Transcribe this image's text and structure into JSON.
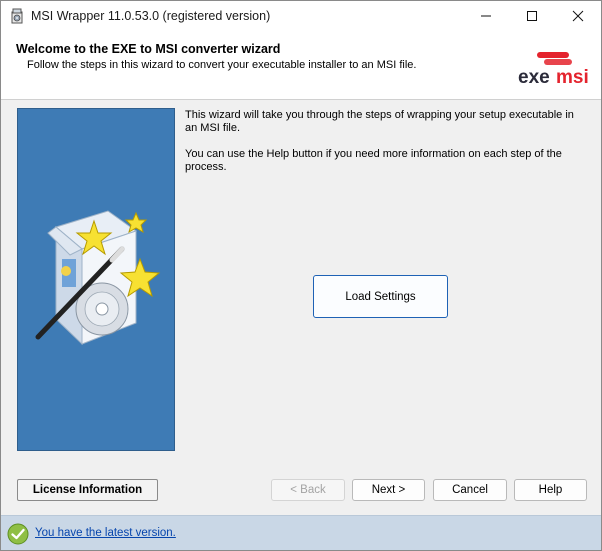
{
  "window": {
    "title": "MSI Wrapper 11.0.53.0 (registered version)"
  },
  "header": {
    "title": "Welcome to the EXE to MSI converter wizard",
    "subtitle": "Follow the steps in this wizard to convert your executable installer to an MSI file.",
    "logo": {
      "text_dark": "exe",
      "text_red": "msi",
      "brand_color": "#e4232d",
      "dark_color": "#2b2b3a"
    }
  },
  "main": {
    "paragraphs": [
      "This wizard will take you through the steps of wrapping your setup executable in an MSI file.",
      "You can use the Help button if you need more information on each step of the process."
    ],
    "load_settings_label": "Load Settings"
  },
  "footer": {
    "license_label": "License Information",
    "back_label": "< Back",
    "next_label": "Next >",
    "cancel_label": "Cancel",
    "help_label": "Help"
  },
  "statusbar": {
    "text": "You have the latest version."
  },
  "colors": {
    "side_panel": "#3e7bb5",
    "status_bar": "#c9d7e6",
    "focus_border": "#1e62b5"
  }
}
